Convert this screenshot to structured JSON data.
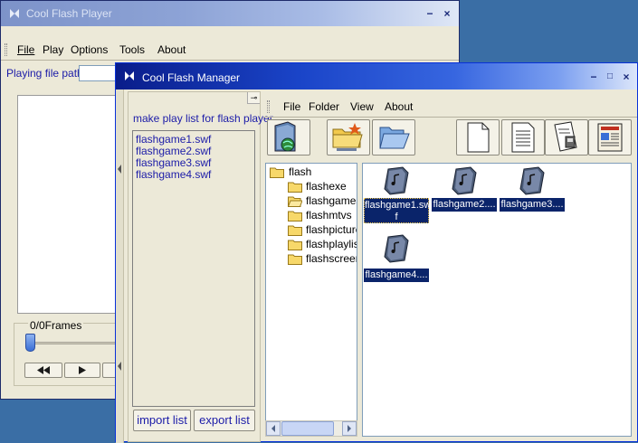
{
  "player": {
    "title": "Cool Flash Player",
    "menu": [
      "File",
      "Play",
      "Options",
      "Tools",
      "About"
    ],
    "path_label": "Playing file path:",
    "frames_label": "0/0Frames"
  },
  "manager": {
    "title": "Cool Flash Manager",
    "menu": [
      "File",
      "Folder",
      "View",
      "About"
    ],
    "playlist_heading": "make play list for flash player",
    "playlist": [
      "flashgame1.swf",
      "flashgame2.swf",
      "flashgame3.swf",
      "flashgame4.swf"
    ],
    "import_label": "import list",
    "export_label": "export list",
    "tree_root": "flash",
    "tree_children": [
      "flashexe",
      "flashgames",
      "flashmtvs",
      "flashpicture",
      "flashplaylist",
      "flashscreens"
    ],
    "files": [
      "flashgame1.swf",
      "flashgame2....",
      "flashgame3....",
      "flashgame4...."
    ],
    "file1_line1": "flashgame1.sw",
    "file1_line2": "f"
  },
  "colors": {
    "desktop": "#3a6ea5",
    "selection": "#0a246a",
    "title_active": "#1432b4"
  }
}
